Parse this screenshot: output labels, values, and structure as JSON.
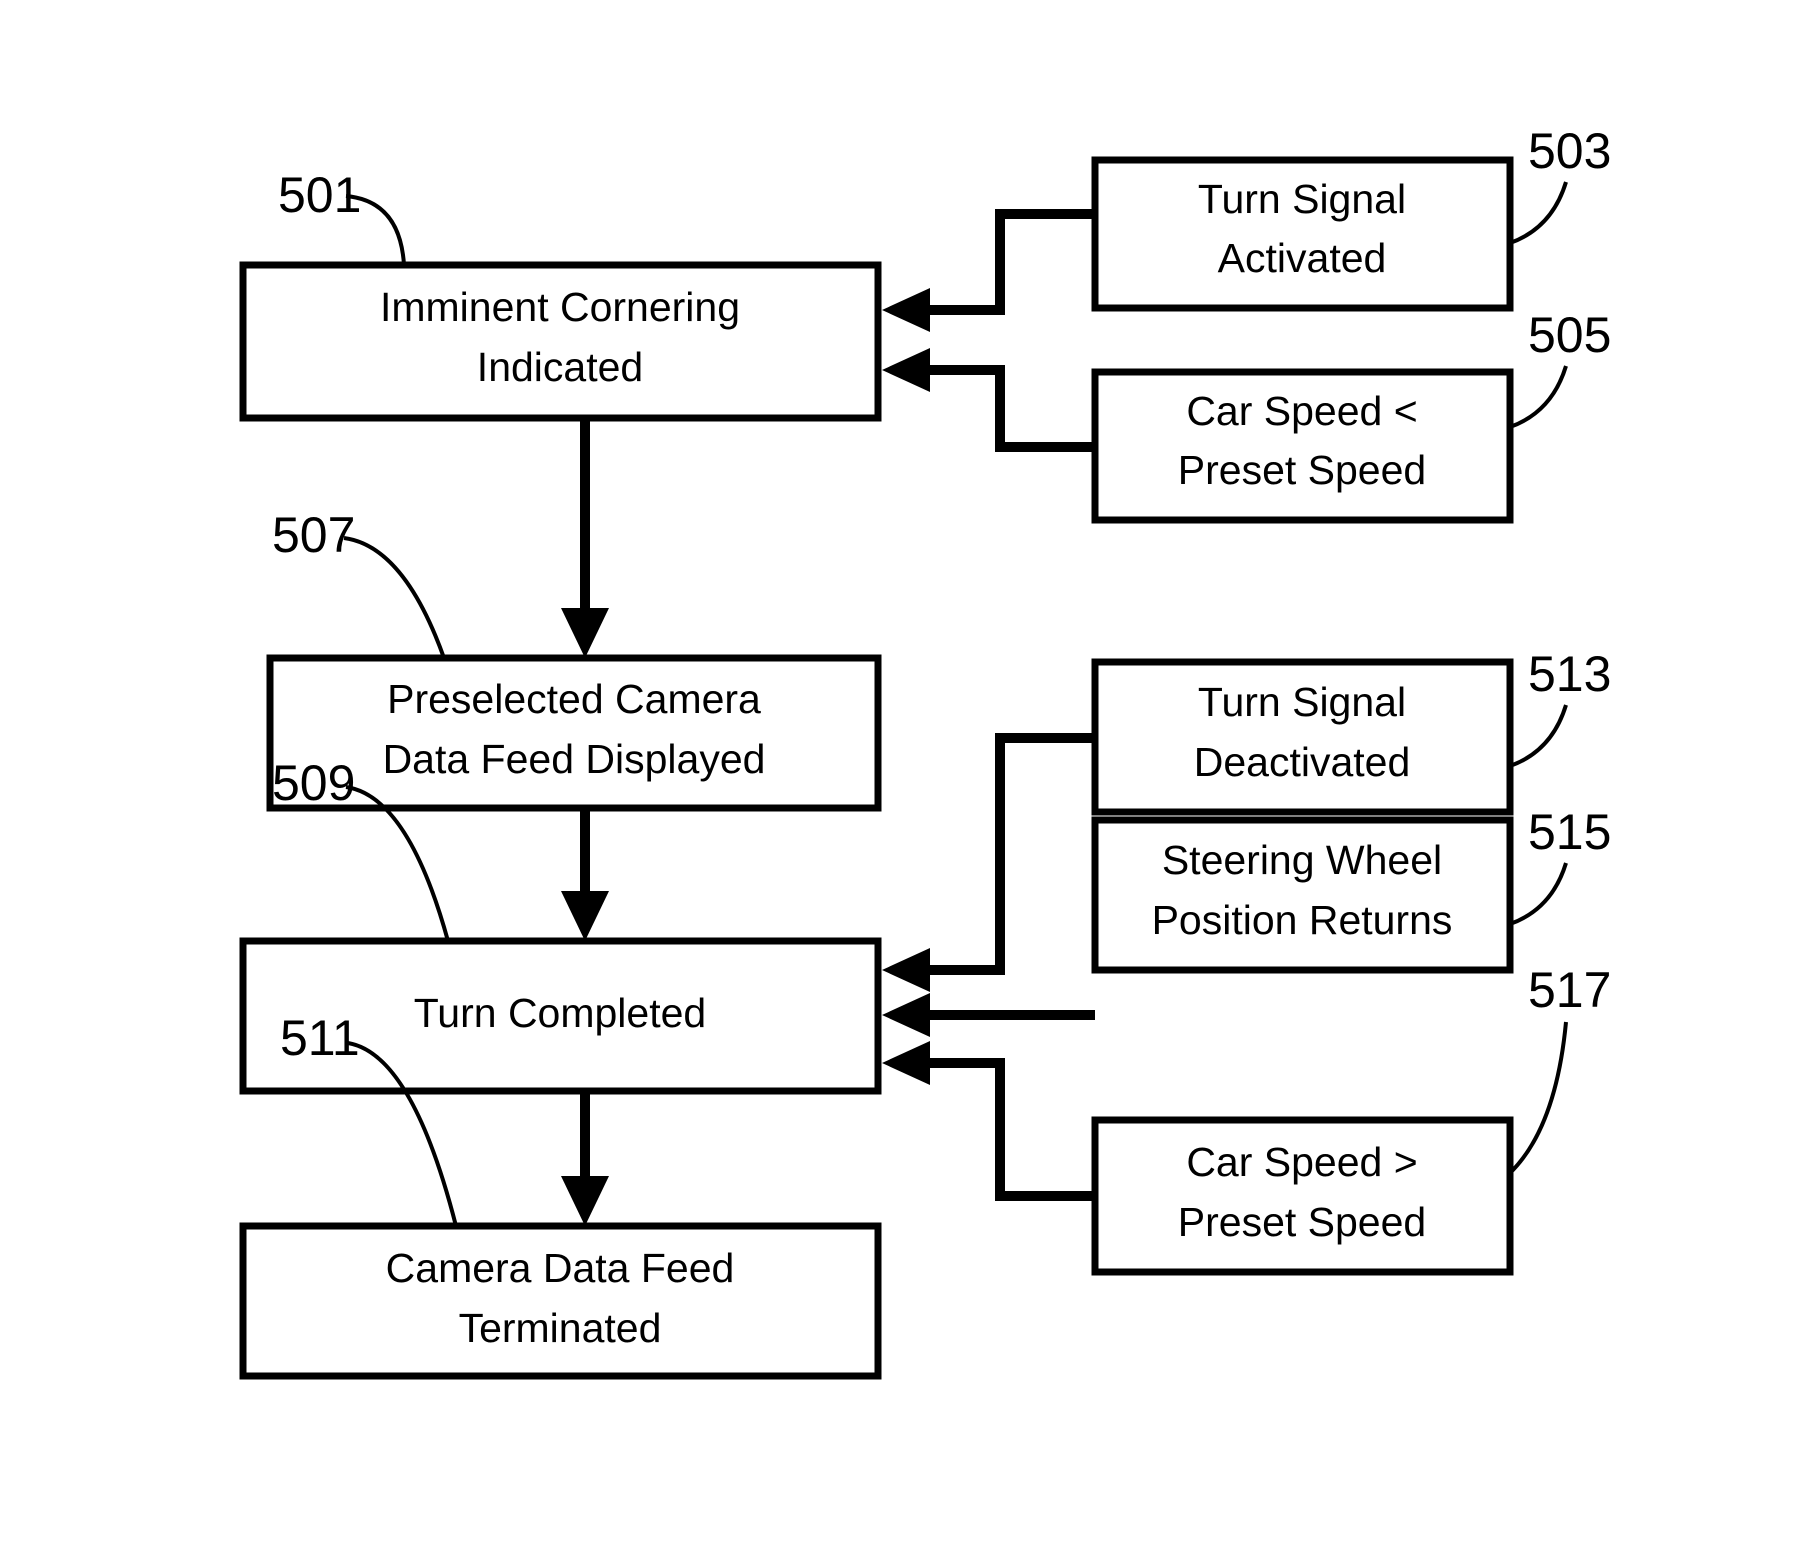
{
  "figure": {
    "type": "patent-flowchart",
    "background_color": "#ffffff",
    "line_color": "#000000"
  },
  "boxes": [
    {
      "id": "box-501",
      "ref": "501",
      "line1": "Imminent Cornering",
      "line2": "Indicated",
      "column": "left"
    },
    {
      "id": "box-503",
      "ref": "503",
      "line1": "Turn Signal",
      "line2": "Activated",
      "column": "right"
    },
    {
      "id": "box-505",
      "ref": "505",
      "line1": "Car Speed <",
      "line2": "Preset Speed",
      "column": "right"
    },
    {
      "id": "box-507",
      "ref": "507",
      "line1": "Preselected Camera",
      "line2": "Data Feed Displayed",
      "column": "left"
    },
    {
      "id": "box-509",
      "ref": "509",
      "line1": "Turn Completed",
      "line2": "",
      "column": "left"
    },
    {
      "id": "box-511",
      "ref": "511",
      "line1": "Camera Data Feed",
      "line2": "Terminated",
      "column": "left"
    },
    {
      "id": "box-513",
      "ref": "513",
      "line1": "Turn Signal",
      "line2": "Deactivated",
      "column": "right"
    },
    {
      "id": "box-515",
      "ref": "515",
      "line1": "Steering Wheel",
      "line2": "Position Returns",
      "column": "right"
    },
    {
      "id": "box-517",
      "ref": "517",
      "line1": "Car Speed >",
      "line2": "Preset Speed",
      "column": "right"
    }
  ],
  "connections": [
    {
      "id": "conn-503-501",
      "from": "503",
      "to": "501",
      "kind": "elbow-arrow-left"
    },
    {
      "id": "conn-505-501",
      "from": "505",
      "to": "501",
      "kind": "elbow-arrow-left"
    },
    {
      "id": "conn-501-507",
      "from": "501",
      "to": "507",
      "kind": "straight-arrow-down"
    },
    {
      "id": "conn-507-509",
      "from": "507",
      "to": "509",
      "kind": "straight-arrow-down"
    },
    {
      "id": "conn-509-511",
      "from": "509",
      "to": "511",
      "kind": "straight-arrow-down"
    },
    {
      "id": "conn-513-509",
      "from": "513",
      "to": "509",
      "kind": "elbow-arrow-left"
    },
    {
      "id": "conn-515-509",
      "from": "515",
      "to": "509",
      "kind": "straight-arrow-left"
    },
    {
      "id": "conn-517-509",
      "from": "517",
      "to": "509",
      "kind": "elbow-arrow-left"
    }
  ]
}
